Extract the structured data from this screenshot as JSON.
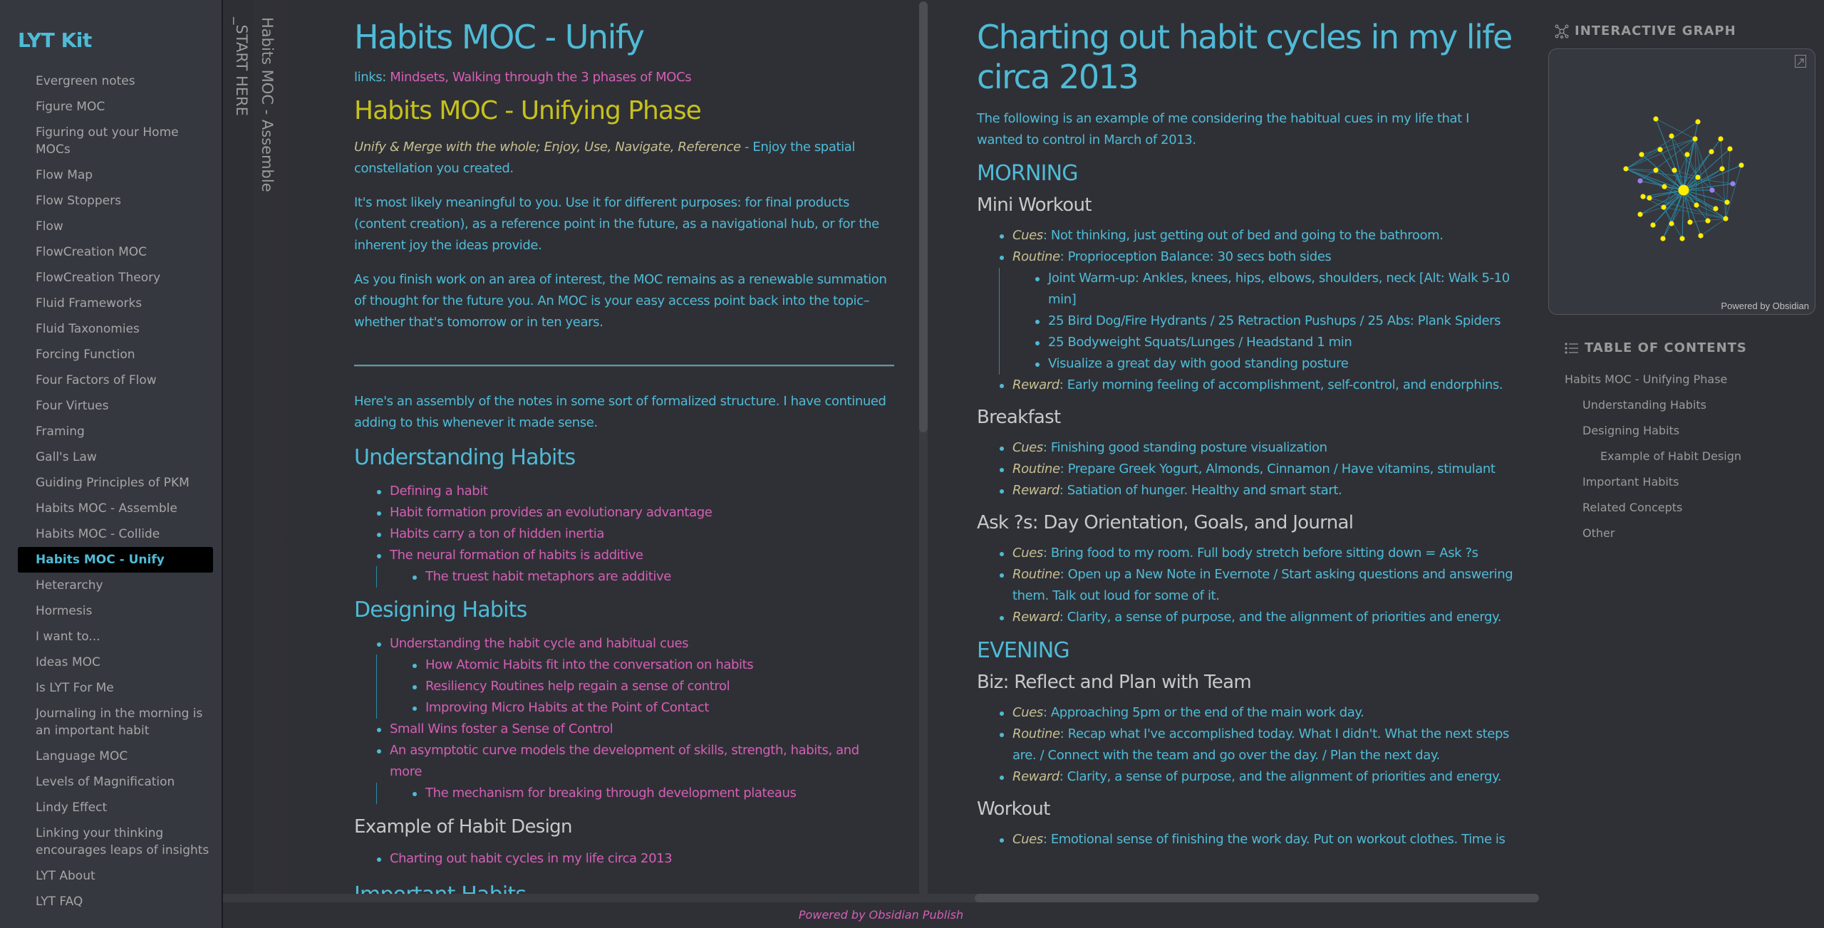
{
  "site": {
    "title": "LYT Kit"
  },
  "sidebar": {
    "items": [
      {
        "label": "Evergreen notes"
      },
      {
        "label": "Figure MOC"
      },
      {
        "label": "Figuring out your Home MOCs"
      },
      {
        "label": "Flow Map"
      },
      {
        "label": "Flow Stoppers"
      },
      {
        "label": "Flow"
      },
      {
        "label": "FlowCreation MOC"
      },
      {
        "label": "FlowCreation Theory"
      },
      {
        "label": "Fluid Frameworks"
      },
      {
        "label": "Fluid Taxonomies"
      },
      {
        "label": "Forcing Function"
      },
      {
        "label": "Four Factors of Flow"
      },
      {
        "label": "Four Virtues"
      },
      {
        "label": "Framing"
      },
      {
        "label": "Gall's Law"
      },
      {
        "label": "Guiding Principles of PKM"
      },
      {
        "label": "Habits MOC - Assemble"
      },
      {
        "label": "Habits MOC - Collide"
      },
      {
        "label": "Habits MOC - Unify",
        "active": true
      },
      {
        "label": "Heterarchy"
      },
      {
        "label": "Hormesis"
      },
      {
        "label": "I want to..."
      },
      {
        "label": "Ideas MOC"
      },
      {
        "label": "Is LYT For Me"
      },
      {
        "label": "Journaling in the morning is an important habit"
      },
      {
        "label": "Language MOC"
      },
      {
        "label": "Levels of Magnification"
      },
      {
        "label": "Lindy Effect"
      },
      {
        "label": "Linking your thinking encourages leaps of insights"
      },
      {
        "label": "LYT About"
      },
      {
        "label": "LYT FAQ"
      }
    ]
  },
  "spines": [
    {
      "label": "_START HERE"
    },
    {
      "label": "Habits MOC - Assemble"
    }
  ],
  "note1": {
    "title": "Habits MOC - Unify",
    "links_label": "links:",
    "links": [
      {
        "label": "Mindsets"
      },
      {
        "label": "Walking through the 3 phases of MOCs"
      }
    ],
    "heading": "Habits MOC - Unifying Phase",
    "intro_italic": "Unify & Merge with the whole; Enjoy, Use, Navigate, Reference",
    "intro_rest": " - Enjoy the spatial constellation you created.",
    "para1": "It's most likely meaningful to you. Use it for different purposes: for final products (content creation), as a reference point in the future, as a navigational hub, or for the inherent joy the ideas provide.",
    "para2": "As you finish work on an area of interest, the MOC remains as a renewable summation of thought for the future you. An MOC is your easy access point back into the topic–whether that's tomorrow or in ten years.",
    "para3": "Here's an assembly of the notes in some sort of formalized structure. I have continued adding to this whenever it made sense.",
    "sections": {
      "understanding": {
        "heading": "Understanding Habits",
        "items": [
          "Defining a habit",
          "Habit formation provides an evolutionary advantage",
          "Habits carry a ton of hidden inertia",
          "The neural formation of habits is additive"
        ],
        "sub": [
          "The truest habit metaphors are additive"
        ]
      },
      "designing": {
        "heading": "Designing Habits",
        "item1": "Understanding the habit cycle and habitual cues",
        "sub1": [
          "How Atomic Habits fit into the conversation on habits",
          "Resiliency Routines help regain a sense of control",
          "Improving Micro Habits at the Point of Contact"
        ],
        "item2": "Small Wins foster a Sense of Control",
        "item3": "An asymptotic curve models the development of skills, strength, habits, and more",
        "sub3": [
          "The mechanism for breaking through development plateaus"
        ]
      },
      "example": {
        "heading": "Example of Habit Design",
        "items": [
          "Charting out habit cycles in my life circa 2013"
        ]
      },
      "next_heading_partial": "Important Habits"
    }
  },
  "note2": {
    "title": "Charting out habit cycles in my life circa 2013",
    "intro": "The following is an example of me considering the habitual cues in my life that I wanted to control in March of 2013.",
    "labels": {
      "cues": "Cues",
      "routine": "Routine",
      "reward": "Reward"
    },
    "morning": {
      "heading": "MORNING",
      "mini_workout": {
        "heading": "Mini Workout",
        "cues": ": Not thinking, just getting out of bed and going to the bathroom.",
        "routine": ": Proprioception Balance: 30 secs both sides",
        "routine_sub": [
          "Joint Warm-up: Ankles, knees, hips, elbows, shoulders, neck [Alt: Walk 5-10 min]",
          "25 Bird Dog/Fire Hydrants / 25 Retraction Pushups / 25 Abs: Plank Spiders",
          "25 Bodyweight Squats/Lunges / Headstand 1 min",
          "Visualize a great day with good standing posture"
        ],
        "reward": ": Early morning feeling of accomplishment, self-control, and endorphins."
      },
      "breakfast": {
        "heading": "Breakfast",
        "cues": ": Finishing good standing posture visualization",
        "routine": ": Prepare Greek Yogurt, Almonds, Cinnamon / Have vitamins, stimulant",
        "reward": ": Satiation of hunger. Healthy and smart start."
      },
      "ask": {
        "heading": "Ask ?s: Day Orientation, Goals, and Journal",
        "cues": ": Bring food to my room. Full body stretch before sitting down = Ask ?s",
        "routine": ": Open up a New Note in Evernote / Start asking questions and answering them. Talk out loud for some of it.",
        "reward": ": Clarity, a sense of purpose, and the alignment of priorities and energy."
      }
    },
    "evening": {
      "heading": "EVENING",
      "biz": {
        "heading": "Biz: Reflect and Plan with Team",
        "cues": ": Approaching 5pm or the end of the main work day.",
        "routine": ": Recap what I've accomplished today. What I didn't. What the next steps are. / Connect with the team and go over the day. / Plan the next day.",
        "reward": ": Clarity, a sense of purpose, and the alignment of priorities and energy."
      },
      "workout": {
        "heading": "Workout",
        "cues": ": Emotional sense of finishing the work day. Put on workout clothes. Time is"
      }
    }
  },
  "footer": {
    "text": "Powered by Obsidian Publish"
  },
  "graph": {
    "title": "INTERACTIVE GRAPH",
    "powered": "Powered by Obsidian",
    "colors": {
      "node": "#ffee00",
      "unresolved": "#9b7ff0",
      "edge": "#2a8aa3"
    }
  },
  "toc": {
    "title": "TABLE OF CONTENTS",
    "items": [
      {
        "label": "Habits MOC - Unifying Phase",
        "level": 1
      },
      {
        "label": "Understanding Habits",
        "level": 2
      },
      {
        "label": "Designing Habits",
        "level": 2
      },
      {
        "label": "Example of Habit Design",
        "level": 3
      },
      {
        "label": "Important Habits",
        "level": 2
      },
      {
        "label": "Related Concepts",
        "level": 2
      },
      {
        "label": "Other",
        "level": 2
      }
    ]
  }
}
